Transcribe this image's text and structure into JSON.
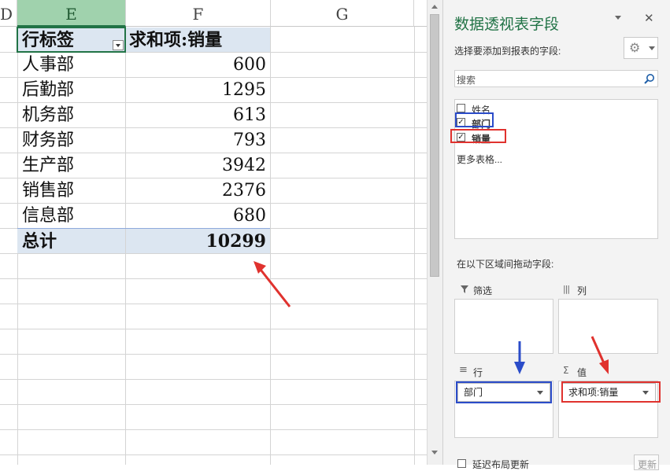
{
  "sheet": {
    "columns": [
      {
        "label": "D"
      },
      {
        "label": "E"
      },
      {
        "label": "F"
      },
      {
        "label": "G"
      }
    ],
    "pivot": {
      "row_header": "行标签",
      "value_header": "求和项:销量",
      "rows": [
        {
          "label": "人事部",
          "value": "600"
        },
        {
          "label": "后勤部",
          "value": "1295"
        },
        {
          "label": "机务部",
          "value": "613"
        },
        {
          "label": "财务部",
          "value": "793"
        },
        {
          "label": "生产部",
          "value": "3942"
        },
        {
          "label": "销售部",
          "value": "2376"
        },
        {
          "label": "信息部",
          "value": "680"
        }
      ],
      "total_label": "总计",
      "total_value": "10299"
    }
  },
  "pane": {
    "title": "数据透视表字段",
    "close_glyph": "✕",
    "choose_label": "选择要添加到报表的字段:",
    "search_placeholder": "搜索",
    "fields": [
      {
        "label": "姓名",
        "checked": false
      },
      {
        "label": "部门",
        "checked": true
      },
      {
        "label": "销量",
        "checked": true
      }
    ],
    "more_tables": "更多表格...",
    "drag_label": "在以下区域间拖动字段:",
    "areas": {
      "filter": "筛选",
      "columns": "列",
      "rows": "行",
      "values": "值"
    },
    "rows_item": "部门",
    "values_item": "求和项:销量",
    "defer_label": "延迟布局更新",
    "update_button": "更新"
  },
  "colors": {
    "header_fill": "#dce6f1",
    "accent_green": "#217346",
    "blue_highlight": "#2b4cc9",
    "red_highlight": "#e0322e"
  }
}
